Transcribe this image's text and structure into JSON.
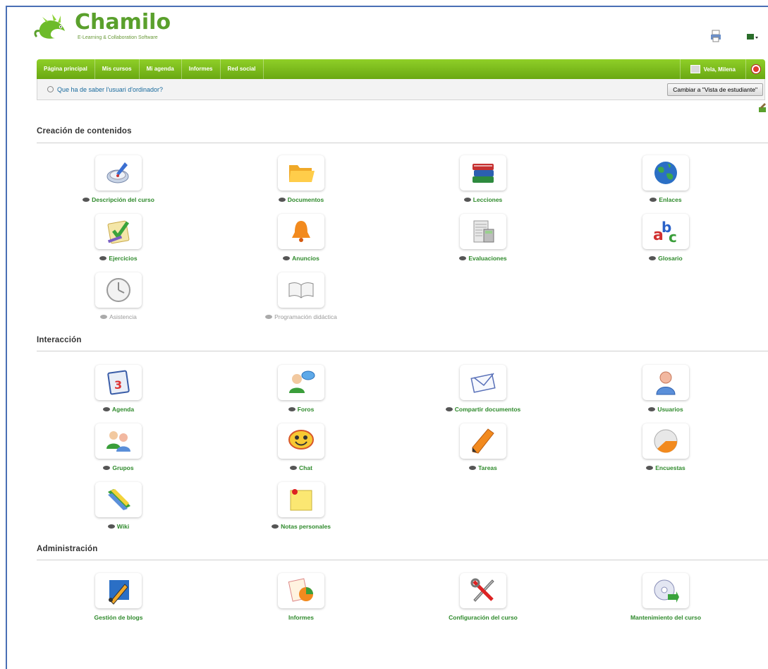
{
  "app": {
    "logo_text": "Chamilo",
    "logo_tagline": "E-Learning & Collaboration Software"
  },
  "navbar": {
    "items": [
      "Página principal",
      "Mis cursos",
      "Mi agenda",
      "Informes",
      "Red social"
    ],
    "user_name": "Vela, Milena"
  },
  "subbar": {
    "help_link": "Que ha de saber l'usuari d'ordinador?",
    "student_view_button": "Cambiar a \"Vista de estudiante\""
  },
  "sections": {
    "content_creation": {
      "title": "Creación de contenidos",
      "tools": [
        {
          "label": "Descripción del curso",
          "icon": "course-description-icon"
        },
        {
          "label": "Documentos",
          "icon": "folder-icon"
        },
        {
          "label": "Lecciones",
          "icon": "books-icon"
        },
        {
          "label": "Enlaces",
          "icon": "globe-icon"
        },
        {
          "label": "Ejercicios",
          "icon": "quiz-icon"
        },
        {
          "label": "Anuncios",
          "icon": "bell-icon"
        },
        {
          "label": "Evaluaciones",
          "icon": "gradebook-icon"
        },
        {
          "label": "Glosario",
          "icon": "glossary-icon"
        },
        {
          "label": "Asistencia",
          "icon": "clock-icon"
        },
        {
          "label": "Programación didáctica",
          "icon": "open-book-icon"
        }
      ]
    },
    "interaction": {
      "title": "Interacción",
      "tools": [
        {
          "label": "Agenda",
          "icon": "calendar-icon"
        },
        {
          "label": "Foros",
          "icon": "forum-icon"
        },
        {
          "label": "Compartir documentos",
          "icon": "envelope-icon"
        },
        {
          "label": "Usuarios",
          "icon": "user-icon"
        },
        {
          "label": "Grupos",
          "icon": "group-icon"
        },
        {
          "label": "Chat",
          "icon": "chat-icon"
        },
        {
          "label": "Tareas",
          "icon": "pencil-icon"
        },
        {
          "label": "Encuestas",
          "icon": "survey-icon"
        },
        {
          "label": "Wiki",
          "icon": "wiki-icon"
        },
        {
          "label": "Notas personales",
          "icon": "note-icon"
        }
      ]
    },
    "administration": {
      "title": "Administración",
      "tools": [
        {
          "label": "Gestión de blogs",
          "icon": "blog-admin-icon"
        },
        {
          "label": "Informes",
          "icon": "reports-icon"
        },
        {
          "label": "Configuración del curso",
          "icon": "settings-tools-icon"
        },
        {
          "label": "Mantenimiento del curso",
          "icon": "maintenance-icon"
        }
      ]
    }
  }
}
